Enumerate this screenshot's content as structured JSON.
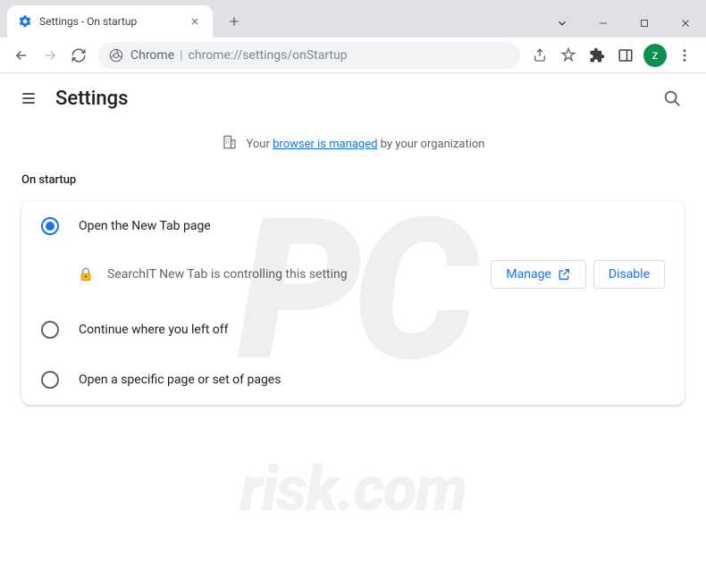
{
  "window": {
    "tab_title": "Settings - On startup"
  },
  "urlbar": {
    "origin_label": "Chrome",
    "url": "chrome://settings/onStartup"
  },
  "avatar": {
    "initial": "z"
  },
  "header": {
    "title": "Settings"
  },
  "managed": {
    "prefix": "Your ",
    "link": "browser is managed",
    "suffix": " by your organization"
  },
  "section": {
    "title": "On startup"
  },
  "options": {
    "new_tab": "Open the New Tab page",
    "continue": "Continue where you left off",
    "specific": "Open a specific page or set of pages"
  },
  "extension": {
    "text": "SearchIT New Tab is controlling this setting",
    "manage": "Manage",
    "disable": "Disable"
  },
  "watermark": {
    "large": "PC",
    "small": "risk.com"
  }
}
